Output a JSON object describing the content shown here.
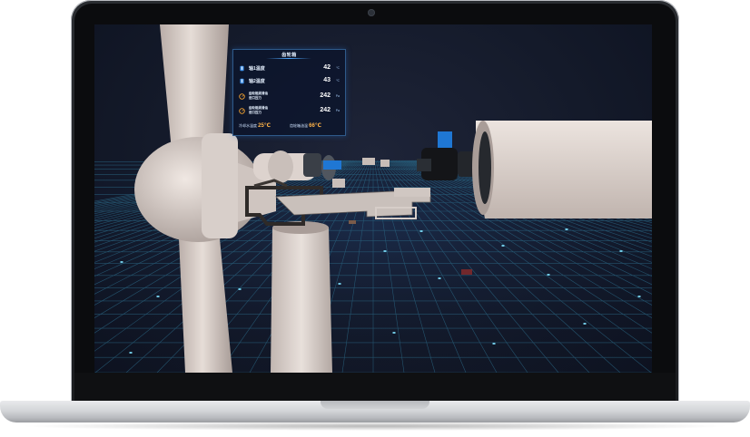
{
  "panel": {
    "title": "齿轮箱",
    "metrics": [
      {
        "label": "轴1温度",
        "value": "42",
        "unit": "℃",
        "icon": "thermometer-icon",
        "small": false
      },
      {
        "label": "轴2温度",
        "value": "43",
        "unit": "℃",
        "icon": "thermometer-icon",
        "small": false
      },
      {
        "label": "齿轮箱润滑油\n进口压力",
        "value": "242",
        "unit": "Pa",
        "icon": "gauge-icon",
        "small": true
      },
      {
        "label": "齿轮箱润滑油\n进口压力",
        "value": "242",
        "unit": "Pa",
        "icon": "gauge-icon",
        "small": true
      }
    ],
    "footer": [
      {
        "label": "冷却水温度",
        "value": "25℃"
      },
      {
        "label": "齿轮箱油温",
        "value": "66℃"
      }
    ]
  },
  "colors": {
    "accent": "#4fa7ff",
    "panel_bg": "#0c162c",
    "grid": "#2f6d8c",
    "highlight": "#ffb347",
    "part_blue": "#1f77d4"
  }
}
